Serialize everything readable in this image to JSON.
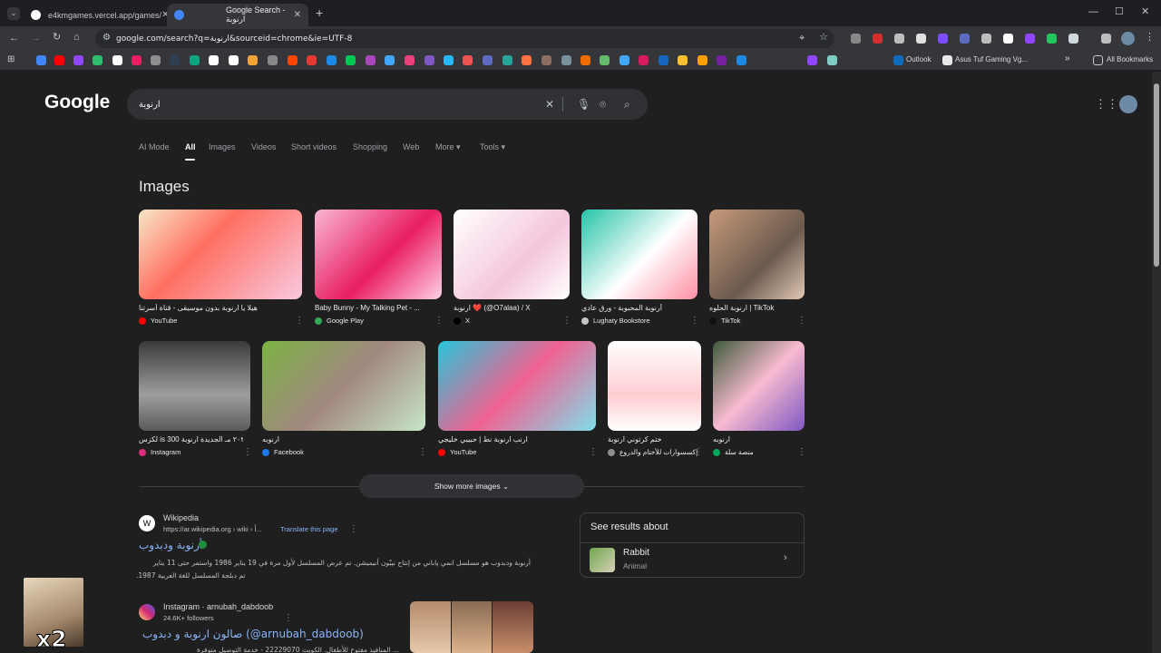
{
  "tabs": [
    {
      "title": "e4kmgames.vercel.app/games/"
    },
    {
      "title": "Google Search - ارنوبة"
    }
  ],
  "new_tab": "+",
  "window_controls": {
    "min": "—",
    "max": "☐",
    "close": "✕"
  },
  "address": {
    "url": "google.com/search?q=ارنوبة&sourceid=chrome&ie=UTF-8"
  },
  "bookmarks": {
    "icon_colors": [
      "#4285f4",
      "#ff0000",
      "#9146ff",
      "#2dbd6e",
      "#ffffff",
      "#e91e63",
      "#8e8e8e",
      "#2c3e50",
      "#10a37f",
      "#ffffff",
      "#ffffff",
      "#f4a23a",
      "#888888",
      "#ff4500",
      "#e53935",
      "#1e88e5",
      "#00c853",
      "#ab47bc",
      "#42a5f5",
      "#ec407a",
      "#7e57c2",
      "#29b6f6",
      "#ef5350",
      "#5c6bc0",
      "#26a69a",
      "#ff7043",
      "#8d6e63",
      "#78909c",
      "#ef6c00",
      "#66bb6a",
      "#42a5f5",
      "#d81b60",
      "#1565c0",
      "#fbc02d",
      "#ffa000",
      "#7b1fa2",
      "#1e88e5",
      "#9146ff",
      "#80cbc4"
    ],
    "outlook": "Outlook",
    "asus": "Asus Tuf Gaming Vg...",
    "overflow": "»",
    "all": "All Bookmarks"
  },
  "google": {
    "logo": "Google",
    "query": "ارنوبة",
    "tabs": [
      "AI Mode",
      "All",
      "Images",
      "Videos",
      "Short videos",
      "Shopping",
      "Web",
      "More ▾",
      "Tools ▾"
    ],
    "images_heading": "Images",
    "images": [
      {
        "title": "هيلا يا ارنوبة بدون موسيقى - قناة أسرتنا",
        "source": "YouTube",
        "color": "#ff0000"
      },
      {
        "title": "Baby Bunny - My Talking Pet - ...",
        "source": "Google Play",
        "color": "#34a853"
      },
      {
        "title": "ارنوبة ❤️ (@O7alaa) / X",
        "source": "X",
        "color": "#000000"
      },
      {
        "title": "أرنوبة المحبوبة - ورق عادي",
        "source": "Lughaty Bookstore",
        "color": "#c4c7c5"
      },
      {
        "title": "ارنوبة الحلوه | TikTok",
        "source": "TikTok",
        "color": "#111111"
      },
      {
        "title": "لكزس is 300 ٢٠٢٤ مـ الجديدة ارنوبة",
        "source": "Instagram",
        "color": "#dd2a7b"
      },
      {
        "title": "ارنوبه",
        "source": "Facebook",
        "color": "#1877f2"
      },
      {
        "title": "ارنب ارنوبة نط | حبيبي خليجي",
        "source": "YouTube",
        "color": "#ff0000"
      },
      {
        "title": "ختم كرتوني ارنوبة",
        "source": "إكسسوارات للأختام والدروع",
        "color": "#8e8e8e"
      },
      {
        "title": "ارنوبه",
        "source": "منصة سلة",
        "color": "#00a65a"
      }
    ],
    "show_more": "Show more images ⌄",
    "results": [
      {
        "site": "Wikipedia",
        "url": "https://ar.wikipedia.org › wiki › أ...",
        "translate": "Translate this page",
        "title": "أرنوبة ودبدوب",
        "snippet1": "أرنوبة ودبدوب هو مسلسل انمي ياباني من إنتاج نيبّون أنيميشن. تم عرض المسلسل لأول مرة في 19 يناير 1986 واستمر حتى 11 يناير",
        "snippet2": ".1987 تم دبلجة المسلسل للغة العربية"
      },
      {
        "site": "Instagram · arnubah_dabdoob",
        "followers": "24.6K+ followers",
        "title": "صالون ارنوبة و دبدوب (@arnubah_dabdoob)",
        "snippet1": "... المنافيذ مفتوح للأطفال. الكويت 22229070 - خدمة التوصيل متوفرة"
      }
    ],
    "sidebar": {
      "heading": "See results about",
      "entity": "Rabbit",
      "type": "Animal"
    }
  },
  "overlay": {
    "label": "x2"
  }
}
